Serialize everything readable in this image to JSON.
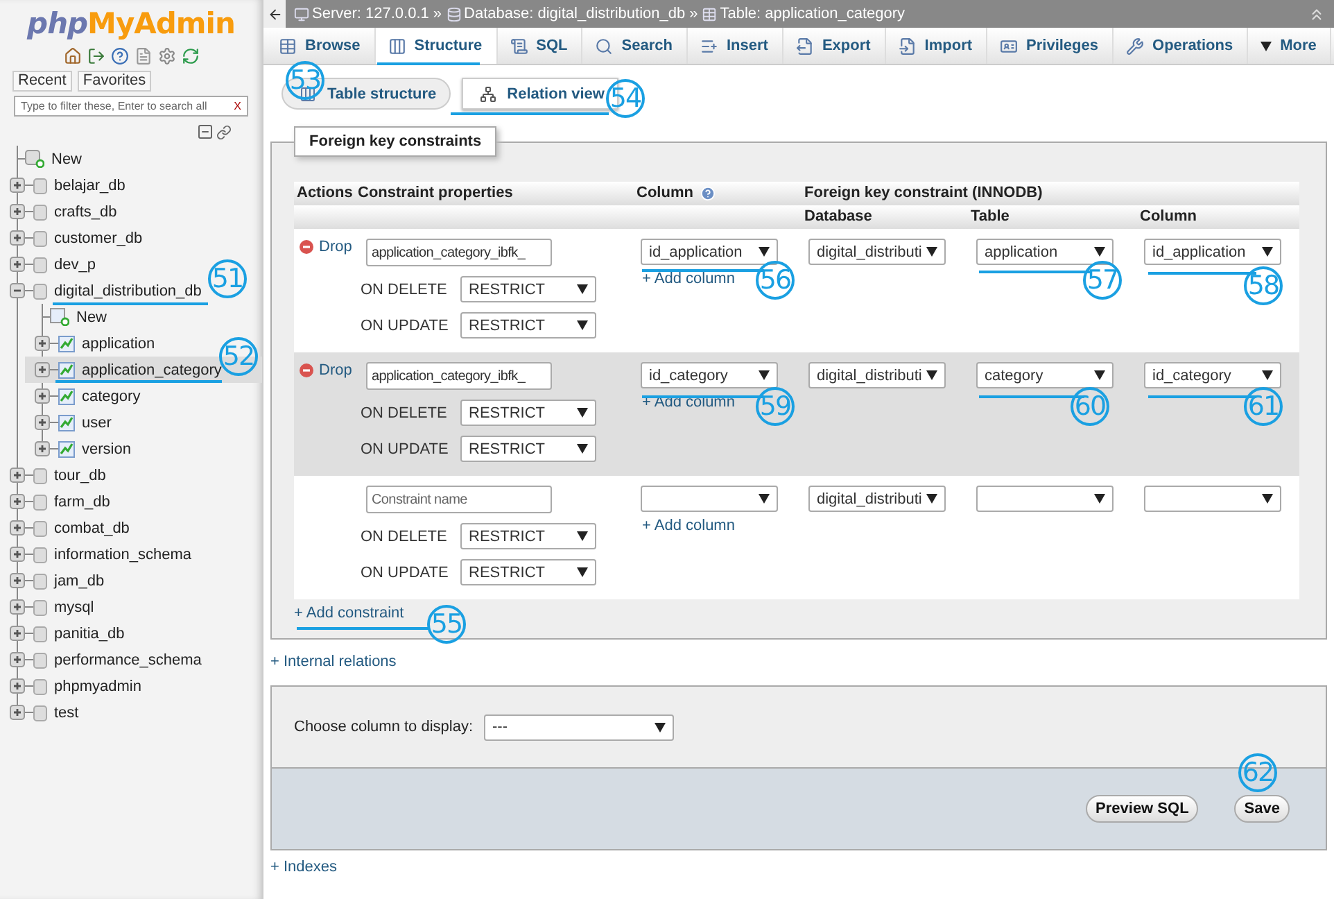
{
  "sidebar": {
    "logo": {
      "prefix": "php",
      "name": "MyAdmin"
    },
    "tabs": [
      {
        "label": "Recent"
      },
      {
        "label": "Favorites"
      }
    ],
    "filter": {
      "placeholder": "Type to filter these, Enter to search all",
      "clear": "X"
    },
    "tree": [
      {
        "label": "New",
        "kind": "new",
        "selected": false
      },
      {
        "label": "belajar_db",
        "kind": "db",
        "expanded": false,
        "selected": false
      },
      {
        "label": "crafts_db",
        "kind": "db",
        "expanded": false,
        "selected": false
      },
      {
        "label": "customer_db",
        "kind": "db",
        "expanded": false,
        "selected": false
      },
      {
        "label": "dev_p",
        "kind": "db",
        "expanded": false,
        "selected": false
      },
      {
        "label": "digital_distribution_db",
        "kind": "db",
        "expanded": true,
        "selected": false,
        "children": [
          {
            "label": "New",
            "kind": "new",
            "selected": false
          },
          {
            "label": "application",
            "kind": "table",
            "expanded": false,
            "selected": false
          },
          {
            "label": "application_category",
            "kind": "table",
            "expanded": false,
            "selected": true
          },
          {
            "label": "category",
            "kind": "table",
            "expanded": false,
            "selected": false
          },
          {
            "label": "user",
            "kind": "table",
            "expanded": false,
            "selected": false
          },
          {
            "label": "version",
            "kind": "table",
            "expanded": false,
            "selected": false
          }
        ]
      },
      {
        "label": "tour_db",
        "kind": "db",
        "expanded": false,
        "selected": false
      },
      {
        "label": "farm_db",
        "kind": "db",
        "expanded": false,
        "selected": false
      },
      {
        "label": "combat_db",
        "kind": "db",
        "expanded": false,
        "selected": false
      },
      {
        "label": "information_schema",
        "kind": "db",
        "expanded": false,
        "selected": false
      },
      {
        "label": "jam_db",
        "kind": "db",
        "expanded": false,
        "selected": false
      },
      {
        "label": "mysql",
        "kind": "db",
        "expanded": false,
        "selected": false
      },
      {
        "label": "panitia_db",
        "kind": "db",
        "expanded": false,
        "selected": false
      },
      {
        "label": "performance_schema",
        "kind": "db",
        "expanded": false,
        "selected": false
      },
      {
        "label": "phpmyadmin",
        "kind": "db",
        "expanded": false,
        "selected": false
      },
      {
        "label": "test",
        "kind": "db",
        "expanded": false,
        "selected": false
      }
    ]
  },
  "breadcrumb": [
    {
      "label": "Server: 127.0.0.1",
      "kind": "server",
      "separator": "»"
    },
    {
      "label": "Database: digital_distribution_db",
      "kind": "database",
      "separator": "»"
    },
    {
      "label": "Table: application_category",
      "kind": "table"
    }
  ],
  "tabs": [
    {
      "label": "Browse",
      "selected": false
    },
    {
      "label": "Structure",
      "selected": true
    },
    {
      "label": "SQL",
      "selected": false
    },
    {
      "label": "Search",
      "selected": false
    },
    {
      "label": "Insert",
      "selected": false
    },
    {
      "label": "Export",
      "selected": false
    },
    {
      "label": "Import",
      "selected": false
    },
    {
      "label": "Privileges",
      "selected": false
    },
    {
      "label": "Operations",
      "selected": false
    },
    {
      "label": "More",
      "selected": false
    }
  ],
  "subtabs": [
    {
      "label": "Table structure",
      "selected": false
    },
    {
      "label": "Relation view",
      "selected": true
    }
  ],
  "constraints": {
    "legend": "Foreign key constraints",
    "header": {
      "actions": "Actions",
      "properties": "Constraint properties",
      "column": "Column",
      "foreign": "Foreign key constraint (INNODB)",
      "database": "Database",
      "table": "Table",
      "ref_column": "Column"
    },
    "rows": [
      {
        "drop": "Drop",
        "name": "application_category_ibfk_",
        "on_delete_label": "ON DELETE",
        "on_delete": "RESTRICT",
        "on_update_label": "ON UPDATE",
        "on_update": "RESTRICT",
        "column": "id_application",
        "add_column": "+ Add column",
        "database": "digital_distributi",
        "table": "application",
        "ref_column": "id_application"
      },
      {
        "drop": "Drop",
        "name": "application_category_ibfk_",
        "on_delete_label": "ON DELETE",
        "on_delete": "RESTRICT",
        "on_update_label": "ON UPDATE",
        "on_update": "RESTRICT",
        "column": "id_category",
        "add_column": "+ Add column",
        "database": "digital_distributi",
        "table": "category",
        "ref_column": "id_category"
      },
      {
        "placeholder": "Constraint name",
        "on_delete_label": "ON DELETE",
        "on_delete": "RESTRICT",
        "on_update_label": "ON UPDATE",
        "on_update": "RESTRICT",
        "add_column": "+ Add column",
        "database": "digital_distributi"
      }
    ],
    "add_constraint": "+ Add constraint"
  },
  "internal_relations": "+ Internal relations",
  "display": {
    "label": "Choose column to display:",
    "value": "---"
  },
  "buttons": [
    "Preview SQL",
    "Save"
  ],
  "indexes": "+ Indexes",
  "callouts": [
    {
      "number": "51"
    },
    {
      "number": "52"
    },
    {
      "number": "53"
    },
    {
      "number": "54"
    },
    {
      "number": "55"
    },
    {
      "number": "56"
    },
    {
      "number": "57"
    },
    {
      "number": "58"
    },
    {
      "number": "59"
    },
    {
      "number": "60"
    },
    {
      "number": "61"
    },
    {
      "number": "62"
    }
  ]
}
